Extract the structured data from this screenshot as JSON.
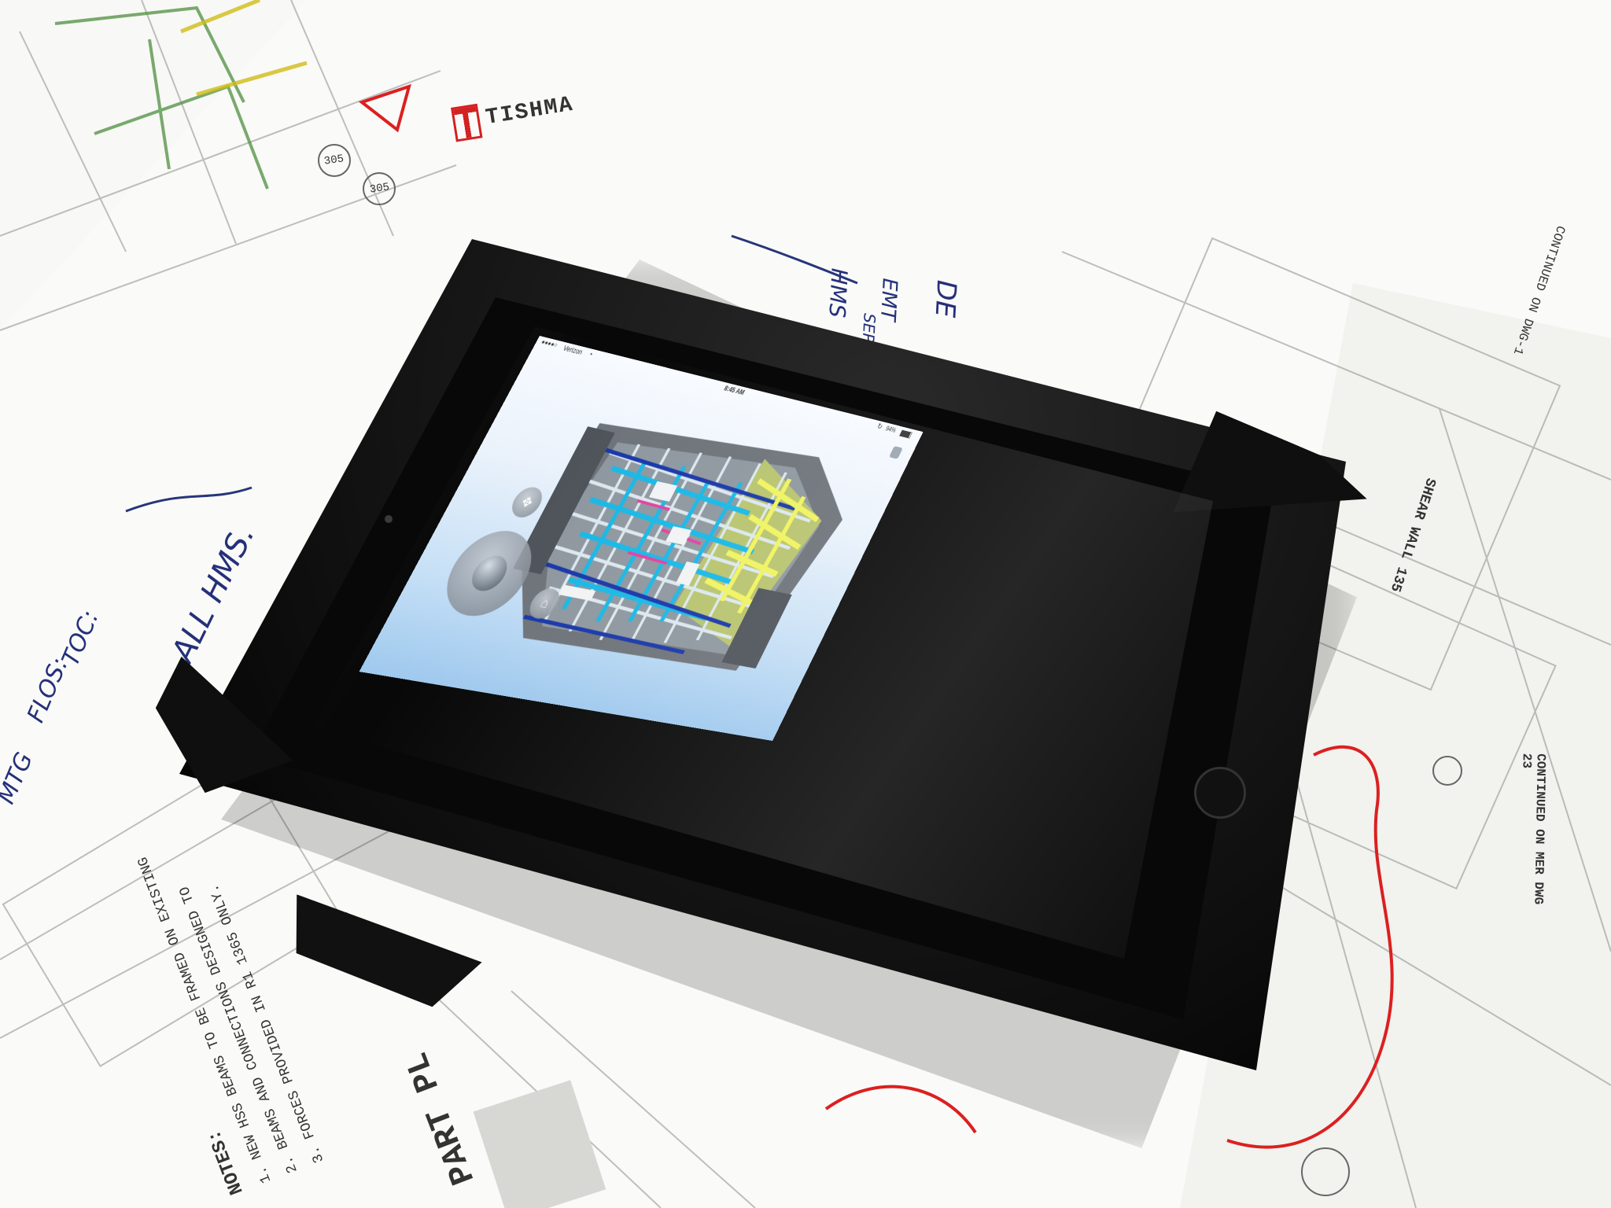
{
  "background_sheets": {
    "brand_text": "TISHMA",
    "sheet_numbers": [
      "305",
      "305"
    ],
    "top_texts": [
      "DE",
      "EMT",
      "SEP",
      "HMS"
    ],
    "left_texts": [
      "- ALL HMS.",
      "TOC:",
      "FLOS:",
      "MTG"
    ],
    "notes_title": "NOTES:",
    "notes_items": [
      "1. NEW HSS BEAMS TO BE FRAMED ON EXISTING",
      "2. BEAMS AND CONNECTIONS DESIGNED TO",
      "3. FORCES PROVIDED IN R1 1365 ONLY."
    ],
    "part_label": "PART PL",
    "right_labels": [
      "CONTINUED ON DWG-1",
      "SHEAR WALL 135",
      "CONTINUED ON MER DWG 23"
    ]
  },
  "tablet": {
    "status_bar": {
      "carrier": "Verizon",
      "time": "8:45 AM",
      "battery": "94%"
    },
    "viewer": {
      "joystick_icon": "joystick-control-icon",
      "orbit_icon": "orbit-icon",
      "home_icon": "home-icon",
      "model_icon": "bim-model-icon"
    }
  }
}
